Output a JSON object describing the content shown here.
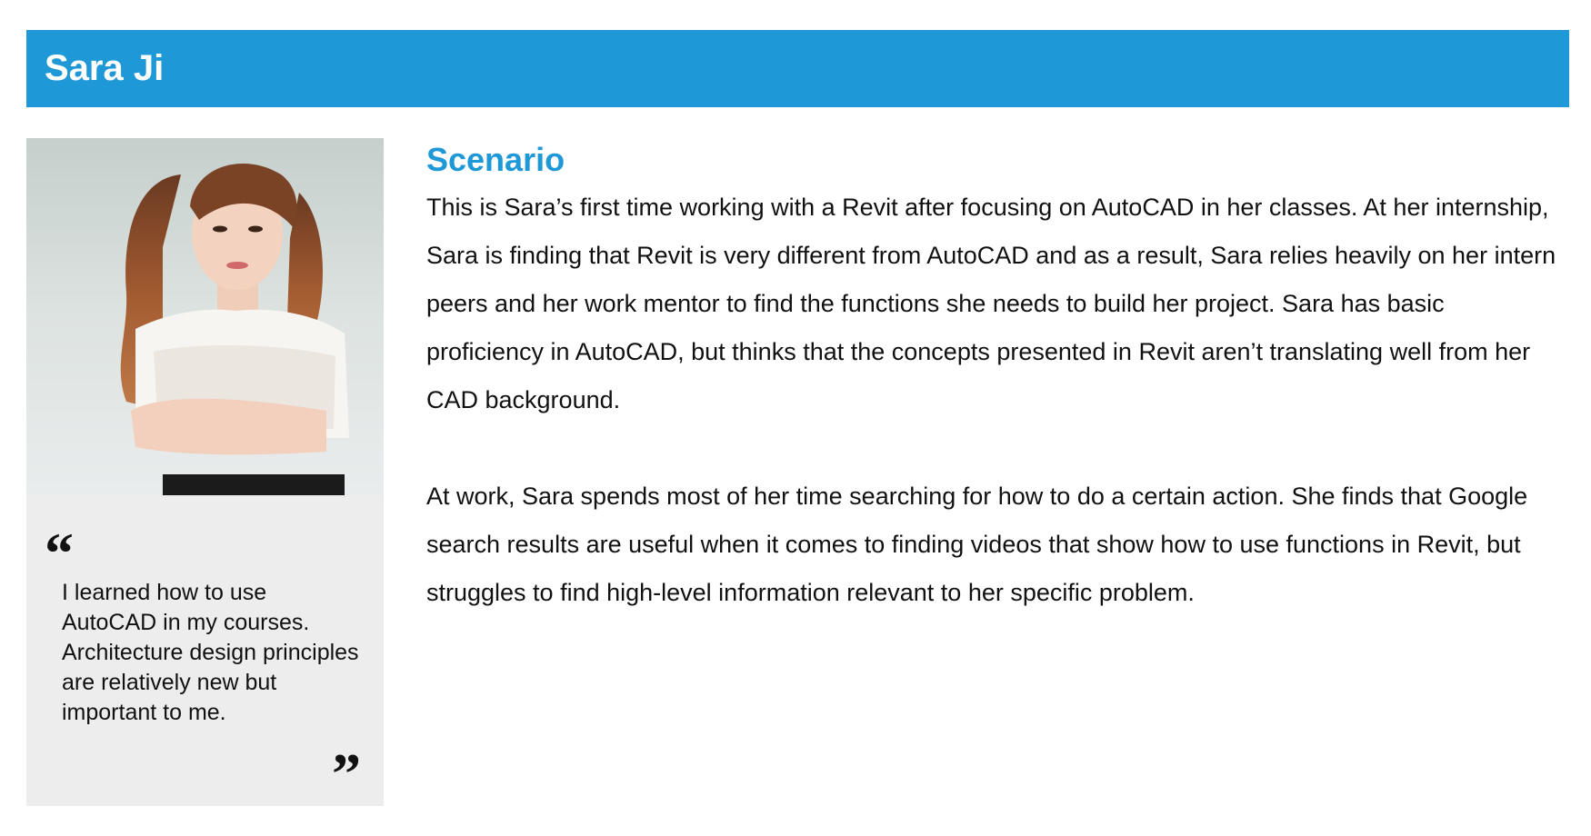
{
  "header": {
    "name": "Sara Ji",
    "accent_color": "#1e98d6"
  },
  "sidebar": {
    "photo": "portrait-photo",
    "quote_open": "“",
    "quote": "I learned how to use AutoCAD in my courses. Architecture design principles are relatively new but important to me.",
    "quote_close": "”"
  },
  "main": {
    "section_title": "Scenario",
    "paragraphs": [
      "This is Sara’s first time working with a Revit after focusing on AutoCAD in her classes. At her internship, Sara is finding that Revit is very different from AutoCAD and as a result, Sara relies heavily on her intern peers and her work mentor to find the functions she needs to build her project. Sara has basic proficiency in AutoCAD, but thinks that the concepts presented in Revit aren’t translating well from her CAD background.",
      "At work, Sara spends most of her time searching for how to do a certain action. She finds that Google search results are useful when it comes to finding videos that show how to use functions in Revit, but struggles to find high-level information relevant to her specific problem."
    ]
  }
}
